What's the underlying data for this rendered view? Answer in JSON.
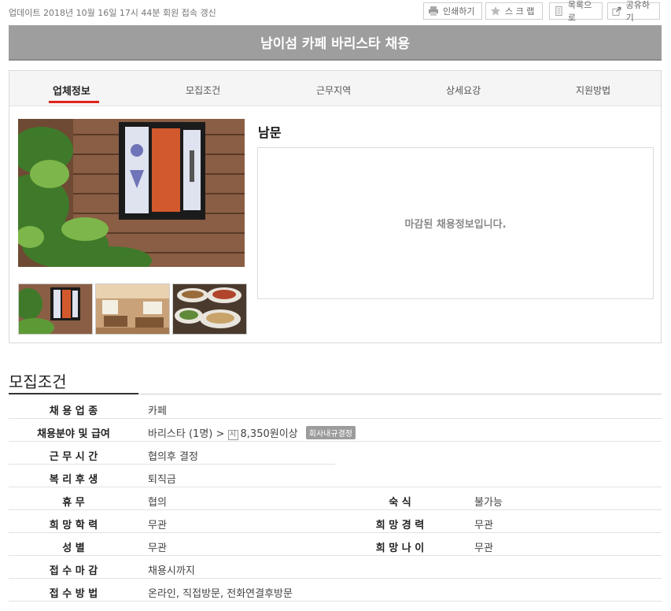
{
  "header": {
    "update_text": "업데이트 2018년 10월 16일 17시 44분 회원 접속 갱신",
    "buttons": {
      "print": "인쇄하기",
      "scrap": "스 크 랩",
      "list": "목록으로",
      "share": "공유하기"
    }
  },
  "title": "남이섬 카페 바리스타 채용",
  "tabs": [
    "업체정보",
    "모집조건",
    "근무지역",
    "상세요강",
    "지원방법"
  ],
  "company": {
    "name": "남문",
    "closed_message": "마감된 채용정보입니다."
  },
  "conditions": {
    "section_title": "모집조건",
    "rows": {
      "industry": {
        "label": "채 용 업 종",
        "value": "카페"
      },
      "field_salary": {
        "label": "채용분야 및 급여",
        "value_field": "바리스타 (1명) >",
        "won": "시",
        "value_pay": "8,350원이상",
        "badge": "회사내규결정"
      },
      "hours": {
        "label": "근 무 시 간",
        "value": "협의후 결정"
      },
      "welfare": {
        "label": "복 리 후 생",
        "value": "퇴직금"
      },
      "holiday": {
        "label": "휴 무",
        "value": "협의"
      },
      "lodging": {
        "label": "숙 식",
        "value": "불가능"
      },
      "education": {
        "label": "희 망 학 력",
        "value": "무관"
      },
      "career": {
        "label": "희 망 경 력",
        "value": "무관"
      },
      "gender": {
        "label": "성 별",
        "value": "무관"
      },
      "age": {
        "label": "희 망 나 이",
        "value": "무관"
      },
      "deadline": {
        "label": "접 수 마 감",
        "value": "채용시까지"
      },
      "method": {
        "label": "접 수 방 법",
        "value": "온라인, 직접방문, 전화연결후방문"
      }
    }
  },
  "colors": {
    "title_bg": "#9e9e9e",
    "tab_active_underline": "#e0241b",
    "badge_bg": "#9c9c9c"
  }
}
